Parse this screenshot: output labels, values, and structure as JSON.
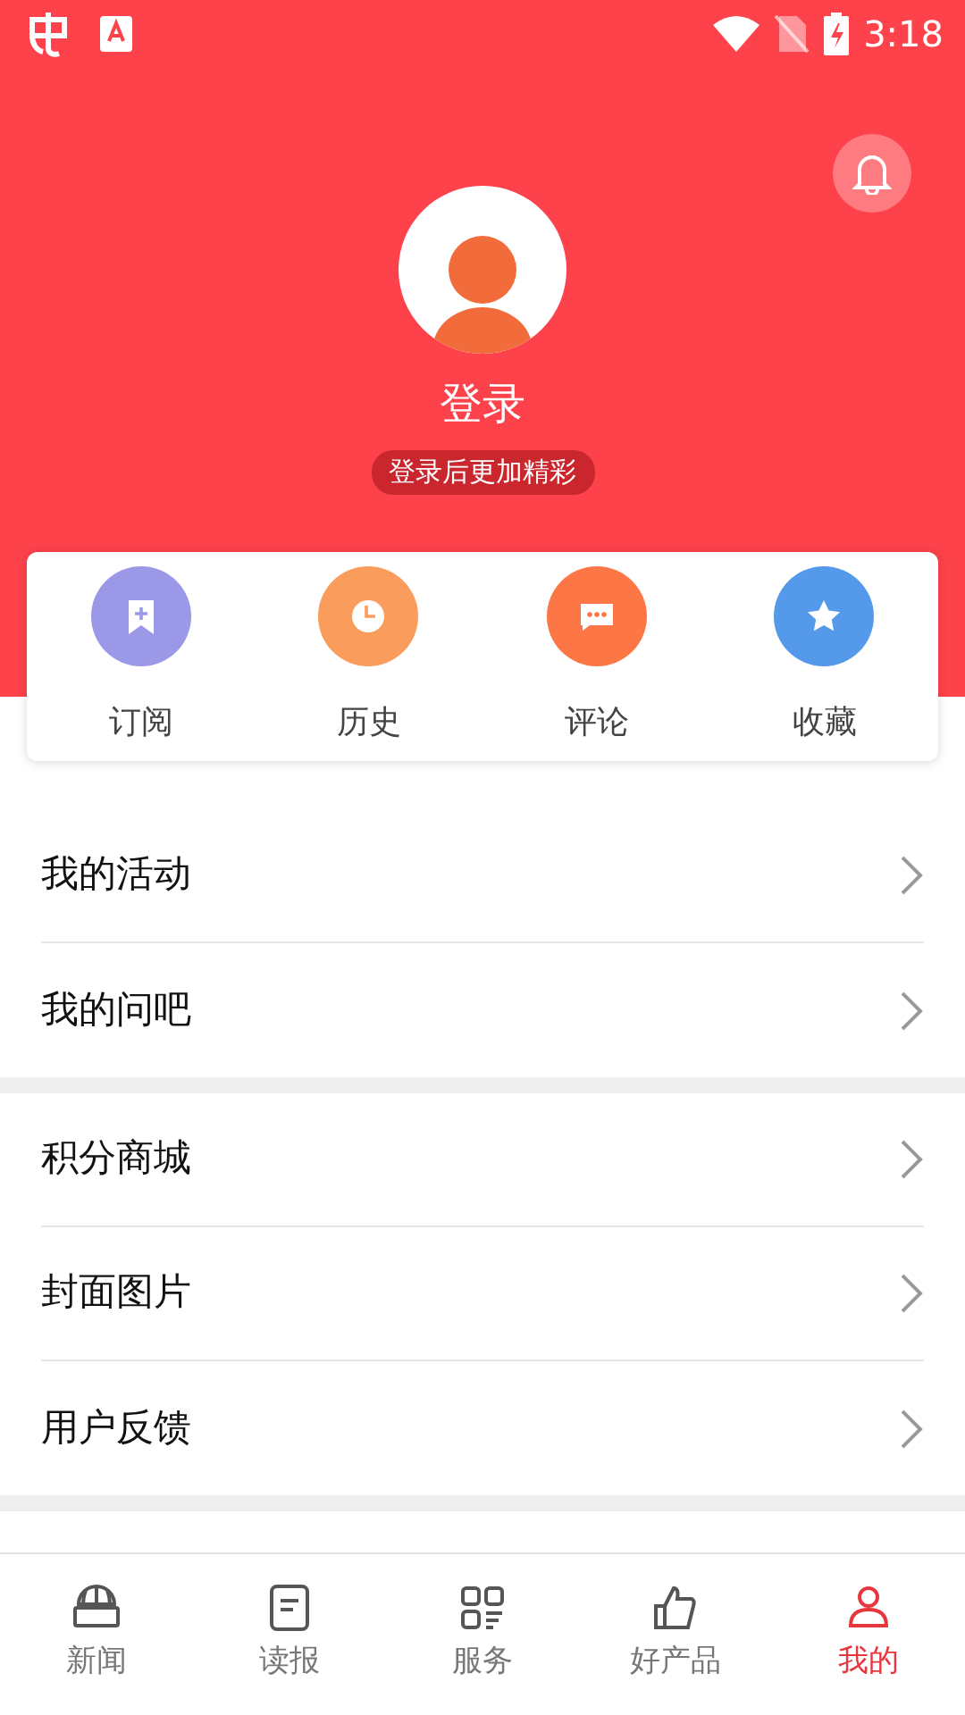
{
  "status_bar": {
    "time": "3:18"
  },
  "profile": {
    "login": "登录",
    "hint": "登录后更加精彩"
  },
  "quick_actions": [
    {
      "kind": "subscribe",
      "label": "订阅",
      "color": "#9b98e8"
    },
    {
      "kind": "history",
      "label": "历史",
      "color": "#fa9c5b"
    },
    {
      "kind": "comment",
      "label": "评论",
      "color": "#fd7646"
    },
    {
      "kind": "favorite",
      "label": "收藏",
      "color": "#5499ea"
    }
  ],
  "menu_groups": [
    {
      "items": [
        "我的活动",
        "我的问吧"
      ]
    },
    {
      "items": [
        "积分商城",
        "封面图片",
        "用户反馈"
      ]
    }
  ],
  "tab_bar": [
    {
      "kind": "news",
      "label": "新闻",
      "selected": false
    },
    {
      "kind": "paper",
      "label": "读报",
      "selected": false
    },
    {
      "kind": "services",
      "label": "服务",
      "selected": false
    },
    {
      "kind": "like",
      "label": "好产品",
      "selected": false
    },
    {
      "kind": "me",
      "label": "我的",
      "selected": true
    }
  ]
}
